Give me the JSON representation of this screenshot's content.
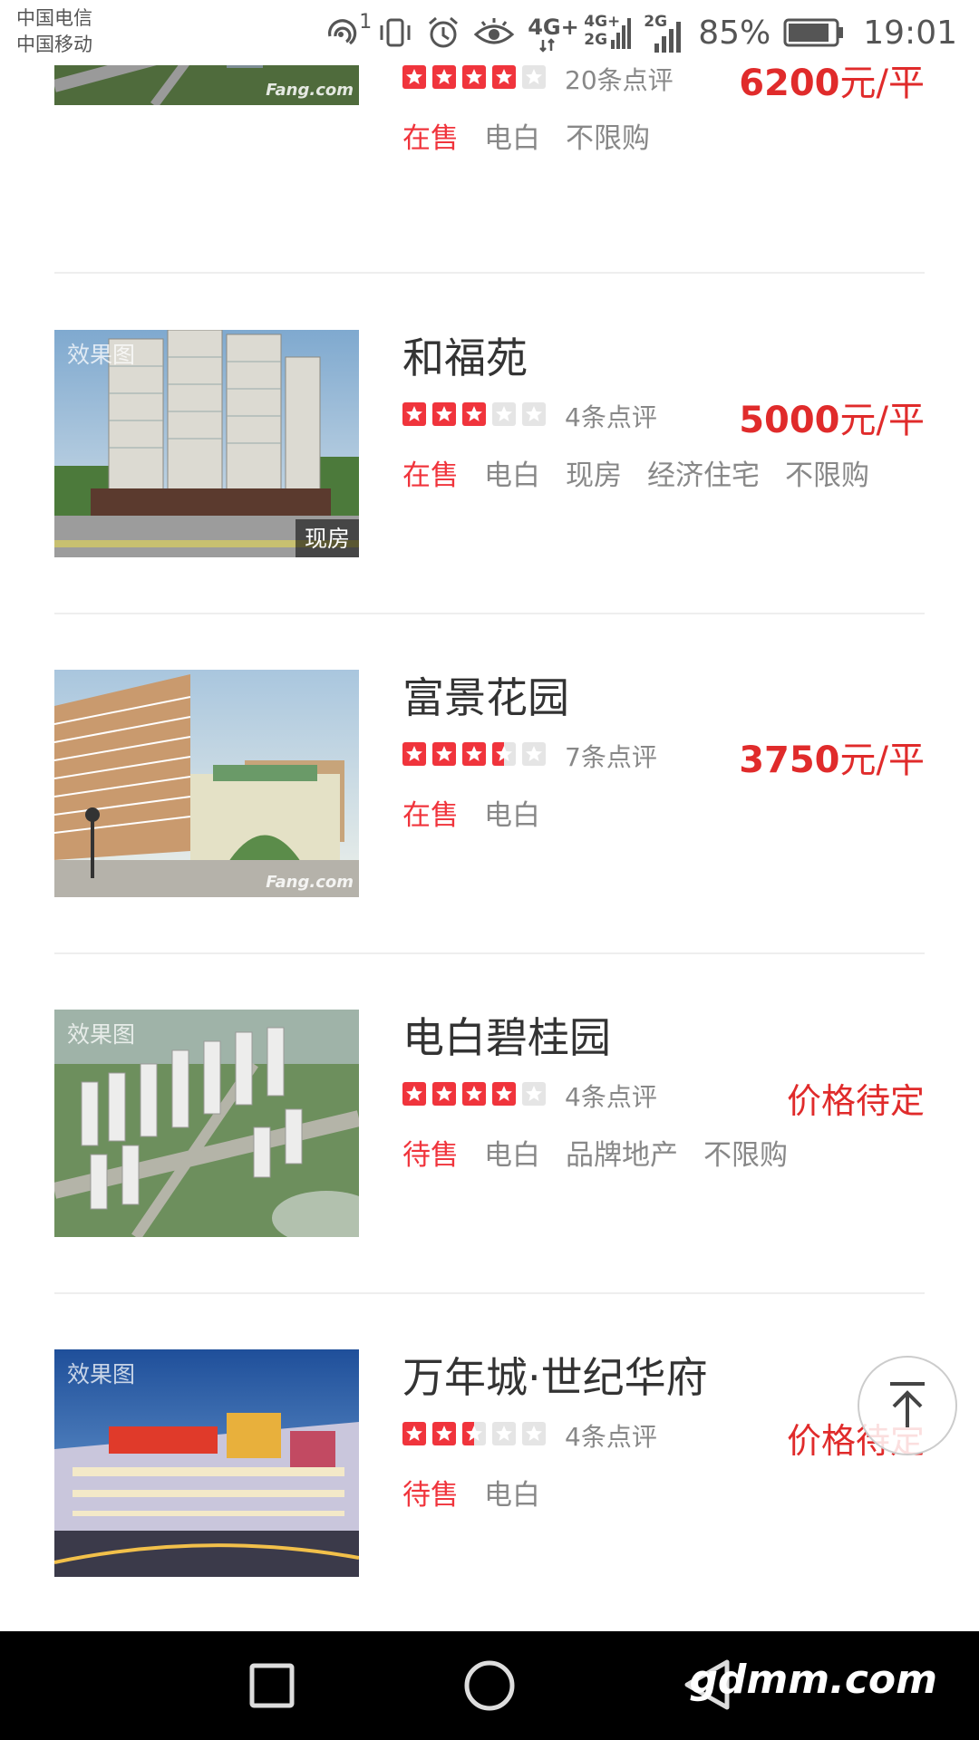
{
  "status_bar": {
    "carrier_1": "中国电信",
    "carrier_2": "中国移动",
    "sim_badge": "1",
    "network_1": "4G+",
    "network_2": "4G+",
    "network_3": "2G",
    "network_4": "2G",
    "battery": "85%",
    "time": "19:01",
    "icons": [
      "hotspot-icon",
      "vibrate-icon",
      "alarm-icon",
      "eye-comfort-icon",
      "signal-4g-icon",
      "signal-2g-icon",
      "battery-icon"
    ]
  },
  "listings": [
    {
      "name": "",
      "rating": 4,
      "reviews": "20条点评",
      "price_value": "6200",
      "price_unit": "元/平",
      "price_text": "",
      "tags": [
        {
          "label": "在售",
          "status": true
        },
        {
          "label": "电白",
          "status": false
        },
        {
          "label": "不限购",
          "status": false
        }
      ],
      "image_tag": "",
      "image_badge": "",
      "watermark": "Fang.com"
    },
    {
      "name": "和福苑",
      "rating": 3,
      "reviews": "4条点评",
      "price_value": "5000",
      "price_unit": "元/平",
      "price_text": "",
      "tags": [
        {
          "label": "在售",
          "status": true
        },
        {
          "label": "电白",
          "status": false
        },
        {
          "label": "现房",
          "status": false
        },
        {
          "label": "经济住宅",
          "status": false
        },
        {
          "label": "不限购",
          "status": false
        }
      ],
      "image_tag": "效果图",
      "image_badge": "现房",
      "watermark": ""
    },
    {
      "name": "富景花园",
      "rating": 3.5,
      "reviews": "7条点评",
      "price_value": "3750",
      "price_unit": "元/平",
      "price_text": "",
      "tags": [
        {
          "label": "在售",
          "status": true
        },
        {
          "label": "电白",
          "status": false
        }
      ],
      "image_tag": "",
      "image_badge": "",
      "watermark": "Fang.com"
    },
    {
      "name": "电白碧桂园",
      "rating": 4,
      "reviews": "4条点评",
      "price_value": "",
      "price_unit": "",
      "price_text": "价格待定",
      "tags": [
        {
          "label": "待售",
          "status": true
        },
        {
          "label": "电白",
          "status": false
        },
        {
          "label": "品牌地产",
          "status": false
        },
        {
          "label": "不限购",
          "status": false
        }
      ],
      "image_tag": "效果图",
      "image_badge": "",
      "watermark": ""
    },
    {
      "name": "万年城·世纪华府",
      "rating": 2.5,
      "reviews": "4条点评",
      "price_value": "",
      "price_unit": "",
      "price_text": "价格待定",
      "tags": [
        {
          "label": "待售",
          "status": true
        },
        {
          "label": "电白",
          "status": false
        }
      ],
      "image_tag": "效果图",
      "image_badge": "",
      "watermark": ""
    }
  ],
  "nav": {
    "buttons": [
      "recents-square-icon",
      "home-circle-icon",
      "back-triangle-icon"
    ],
    "site_mark": "gdmm.com"
  },
  "colors": {
    "accent_red": "#e02b2b",
    "status_red": "#f0343c",
    "tag_gray": "#888888",
    "divider": "#eeeeee"
  }
}
